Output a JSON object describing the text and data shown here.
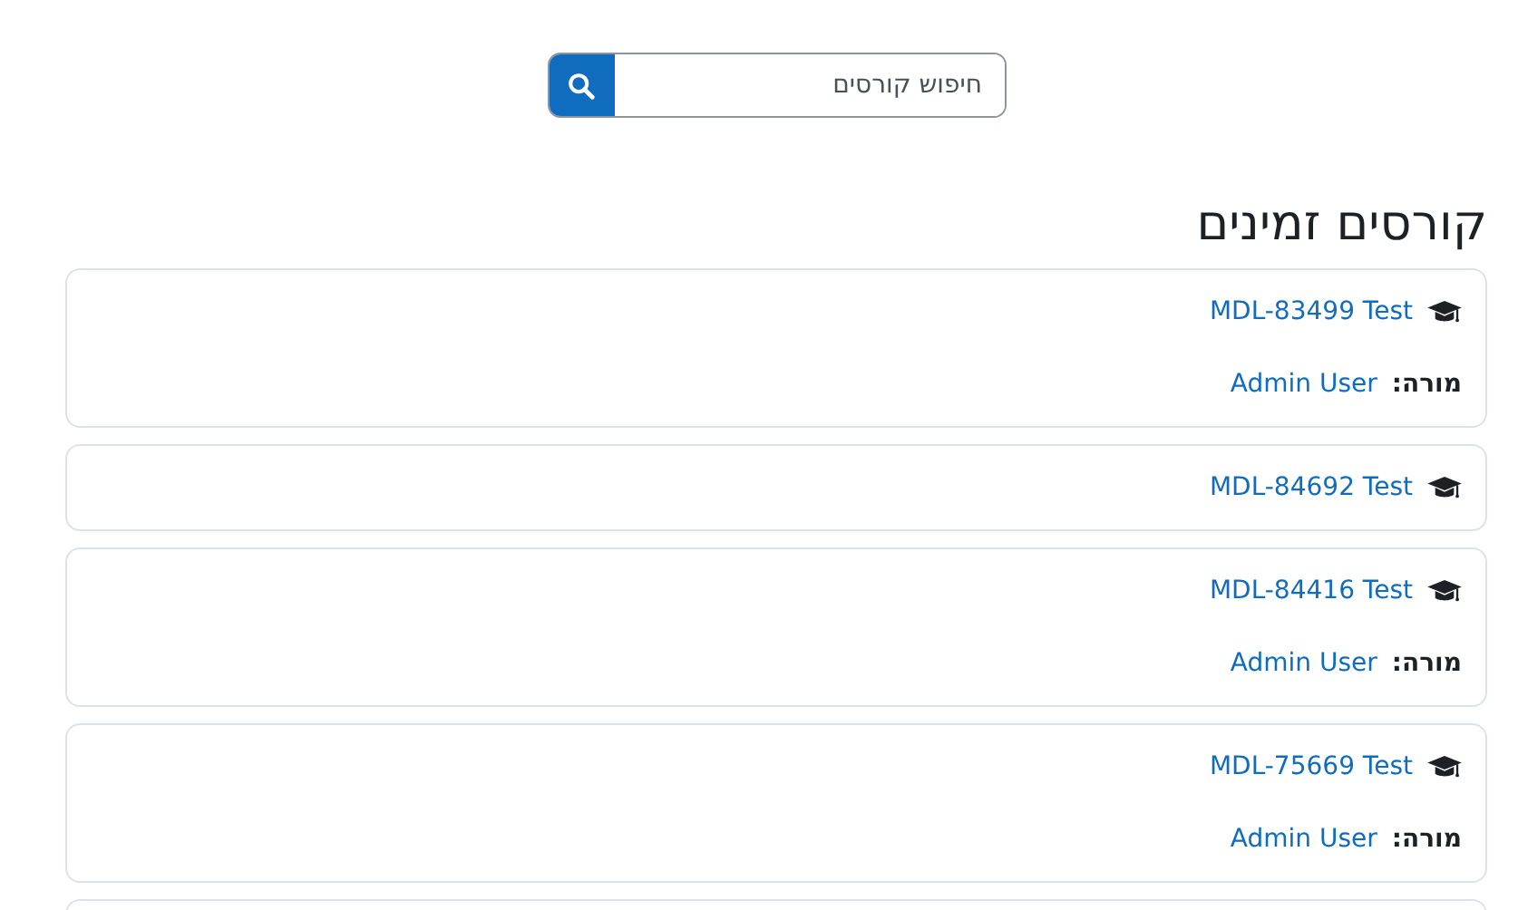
{
  "search": {
    "placeholder": "חיפוש קורסים"
  },
  "heading": "קורסים זמינים",
  "courses": [
    {
      "name": "MDL-83499 Test",
      "teacher_label": "מורה:",
      "teacher": "Admin User"
    },
    {
      "name": "MDL-84692 Test"
    },
    {
      "name": "MDL-84416 Test",
      "teacher_label": "מורה:",
      "teacher": "Admin User"
    },
    {
      "name": "MDL-75669 Test",
      "teacher_label": "מורה:",
      "teacher": "Admin User"
    }
  ]
}
